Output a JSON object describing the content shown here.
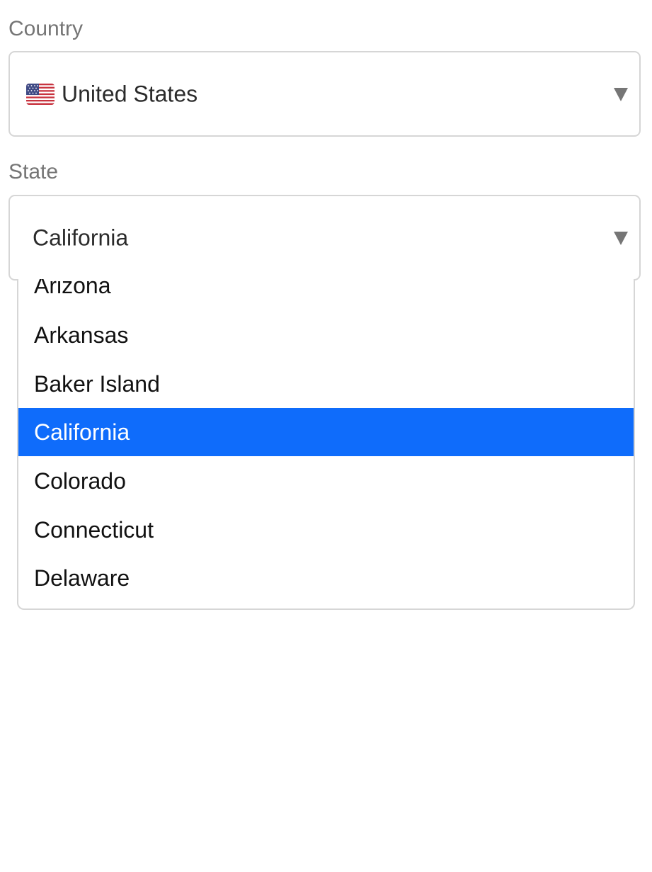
{
  "country": {
    "label": "Country",
    "selected": "United States",
    "flag_icon": "us-flag-icon"
  },
  "state": {
    "label": "State",
    "selected": "California",
    "options": [
      "Arizona",
      "Arkansas",
      "Baker Island",
      "California",
      "Colorado",
      "Connecticut",
      "Delaware"
    ],
    "highlighted_index": 3
  },
  "colors": {
    "highlight": "#0f6cfb",
    "label": "#757575",
    "border": "#d6d6d6"
  }
}
